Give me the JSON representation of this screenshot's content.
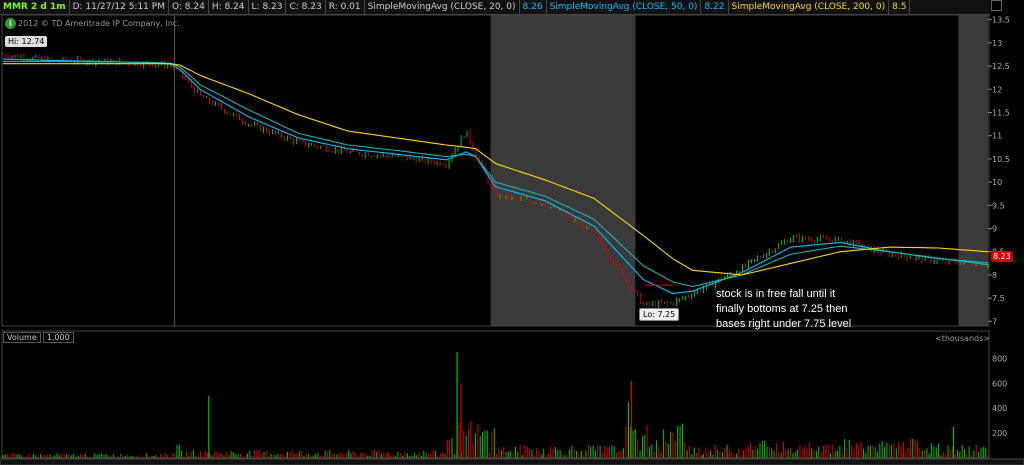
{
  "header": {
    "symbol": "MMR 2 d 1m",
    "datetime": "D: 11/27/12 5:11 PM",
    "open": "O: 8.24",
    "high": "H: 8.24",
    "low": "L: 8.23",
    "close": "C: 8.23",
    "range": "R: 0.01",
    "sma20_label": "SimpleMovingAvg (CLOSE, 20, 0)",
    "sma20_value": "8.26",
    "sma50_label": "SimpleMovingAvg (CLOSE, 50, 0)",
    "sma50_value": "8.22",
    "sma200_label": "SimpleMovingAvg (CLOSE, 200, 0)",
    "sma200_value": "8.5"
  },
  "copyright": "2012 © TD Ameritrade IP Company, Inc.",
  "hi_label": "Hi: 12.74",
  "lo_label": "Lo: 7.25",
  "last_price": "8.23",
  "annotation": "stock is in free fall until it finally bottoms at 7.25 then bases right under 7.75 level",
  "volume_panel": {
    "label": "Volume",
    "scale": "1,000",
    "units": "<thousands>"
  },
  "colors": {
    "up": "#00c800",
    "down": "#e00000",
    "sma20": "#00BFFF",
    "sma50": "#20B2AA",
    "sma200": "#FFD700",
    "shade": "#3a3a3a"
  },
  "chart_data": [
    {
      "type": "line",
      "title": "",
      "y_ticks": [
        "13.5",
        "13",
        "12.5",
        "12",
        "11.5",
        "11",
        "10.5",
        "10",
        "9.5",
        "9",
        "8.5",
        "8",
        "7.5",
        "7"
      ],
      "ylim": [
        6.9,
        13.6
      ],
      "x": [
        0,
        5,
        10,
        15,
        17,
        18,
        20,
        25,
        30,
        35,
        40,
        45,
        47,
        48,
        50,
        55,
        60,
        65,
        68,
        70,
        75,
        80,
        85,
        90,
        95,
        100
      ],
      "series": [
        {
          "name": "price",
          "values": [
            12.75,
            12.62,
            12.6,
            12.55,
            12.52,
            12.35,
            11.85,
            11.25,
            10.85,
            10.65,
            10.55,
            10.4,
            11.1,
            10.6,
            9.7,
            9.55,
            8.9,
            7.35,
            7.4,
            7.6,
            8.15,
            8.8,
            8.75,
            8.45,
            8.3,
            8.23
          ]
        },
        {
          "name": "SimpleMovingAvg (CLOSE, 20, 0)",
          "values": [
            12.65,
            12.62,
            12.6,
            12.57,
            12.54,
            12.42,
            12.0,
            11.4,
            10.95,
            10.72,
            10.6,
            10.48,
            10.65,
            10.55,
            9.9,
            9.6,
            9.05,
            7.9,
            7.6,
            7.65,
            8.05,
            8.6,
            8.7,
            8.5,
            8.35,
            8.26
          ]
        },
        {
          "name": "SimpleMovingAvg (CLOSE, 50, 0)",
          "values": [
            12.6,
            12.6,
            12.59,
            12.58,
            12.56,
            12.48,
            12.1,
            11.55,
            11.05,
            10.8,
            10.68,
            10.55,
            10.6,
            10.55,
            10.0,
            9.7,
            9.2,
            8.2,
            7.85,
            7.75,
            8.0,
            8.45,
            8.62,
            8.5,
            8.36,
            8.22
          ]
        },
        {
          "name": "SimpleMovingAvg (CLOSE, 200, 0)",
          "values": [
            12.55,
            12.55,
            12.55,
            12.55,
            12.55,
            12.52,
            12.3,
            11.9,
            11.45,
            11.1,
            10.95,
            10.8,
            10.75,
            10.72,
            10.4,
            10.05,
            9.65,
            8.85,
            8.35,
            8.1,
            8.0,
            8.25,
            8.5,
            8.6,
            8.58,
            8.5
          ]
        }
      ],
      "shaded_regions": [
        [
          49.5,
          64.2
        ],
        [
          97,
          100
        ]
      ]
    },
    {
      "type": "bar",
      "title": "Volume",
      "y_ticks": [
        "200",
        "400",
        "600",
        "800"
      ],
      "ylim": [
        0,
        900
      ],
      "spikes": [
        {
          "x": 20.9,
          "value": 500,
          "dir": "up"
        },
        {
          "x": 46.1,
          "value": 850,
          "dir": "up"
        },
        {
          "x": 46.5,
          "value": 600,
          "dir": "down"
        },
        {
          "x": 63.8,
          "value": 620,
          "dir": "down"
        },
        {
          "x": 63.5,
          "value": 450,
          "dir": "up"
        },
        {
          "x": 96.5,
          "value": 250,
          "dir": "up"
        }
      ]
    }
  ]
}
